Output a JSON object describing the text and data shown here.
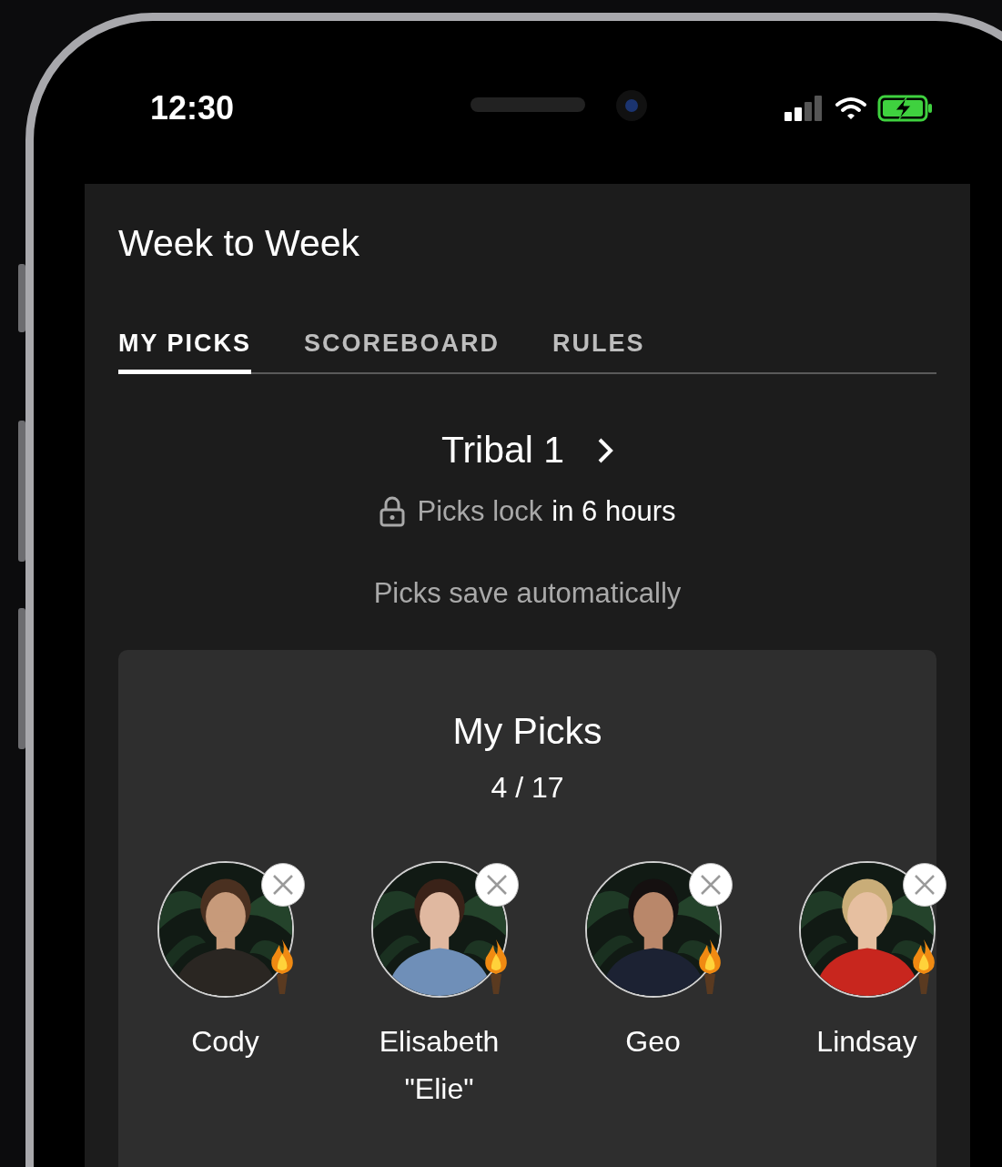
{
  "status_bar": {
    "time": "12:30"
  },
  "header": {
    "title": "Week to Week"
  },
  "tabs": [
    {
      "label": "MY PICKS",
      "selected": true
    },
    {
      "label": "SCOREBOARD",
      "selected": false
    },
    {
      "label": "RULES",
      "selected": false
    }
  ],
  "tribal": {
    "title": "Tribal 1"
  },
  "lock": {
    "label": "Picks lock",
    "time": "in 6 hours"
  },
  "save_note": "Picks save automatically",
  "my_picks": {
    "title": "My Picks",
    "count": "4 / 17",
    "players": [
      {
        "name": "Cody"
      },
      {
        "name": "Elisabeth \"Elie\""
      },
      {
        "name": "Geo"
      },
      {
        "name": "Lindsay"
      }
    ]
  }
}
